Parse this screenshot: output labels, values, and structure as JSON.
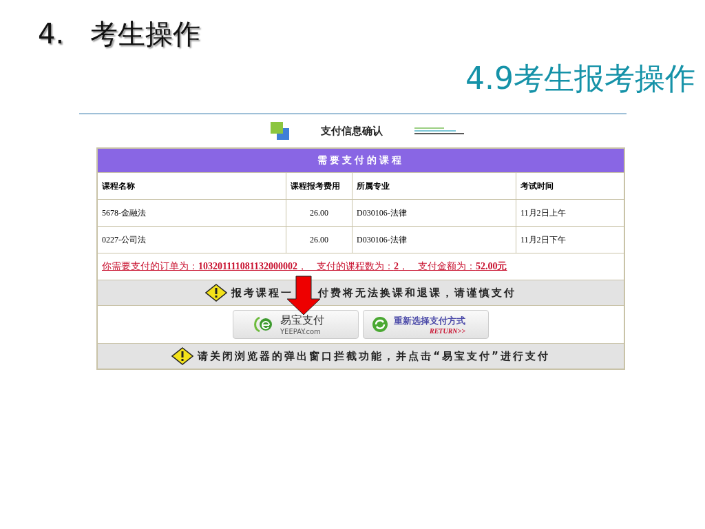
{
  "slide": {
    "number": "4.",
    "title": "考生操作",
    "subtitle": "4.9考生报考操作"
  },
  "page": {
    "title": "支付信息确认",
    "table": {
      "caption": "需要支付的课程",
      "columns": [
        "课程名称",
        "课程报考费用",
        "所属专业",
        "考试时间"
      ],
      "rows": [
        [
          "5678-金融法",
          "26.00",
          "D030106-法律",
          "11月2日上午"
        ],
        [
          "0227-公司法",
          "26.00",
          "D030106-法律",
          "11月2日下午"
        ]
      ]
    },
    "order_summary": "你需要支付的订单为：**103201111081132000002**，　支付的课程数为：**2**，　支付金额为：**52.00元**",
    "warning": [
      "报考课程一",
      "付费将无法换课和退课，请谨慎支付"
    ],
    "buttons": [
      {
        "kind": "yeepay",
        "label": "易宝支付",
        "sublabel": "YEEPAY.com"
      },
      {
        "kind": "return",
        "label": "重新选择支付方式",
        "sublabel": "RETURN>>"
      }
    ],
    "notice": "请关闭浏览器的弹出窗口拦截功能，并点击“易宝支付”进行支付"
  }
}
